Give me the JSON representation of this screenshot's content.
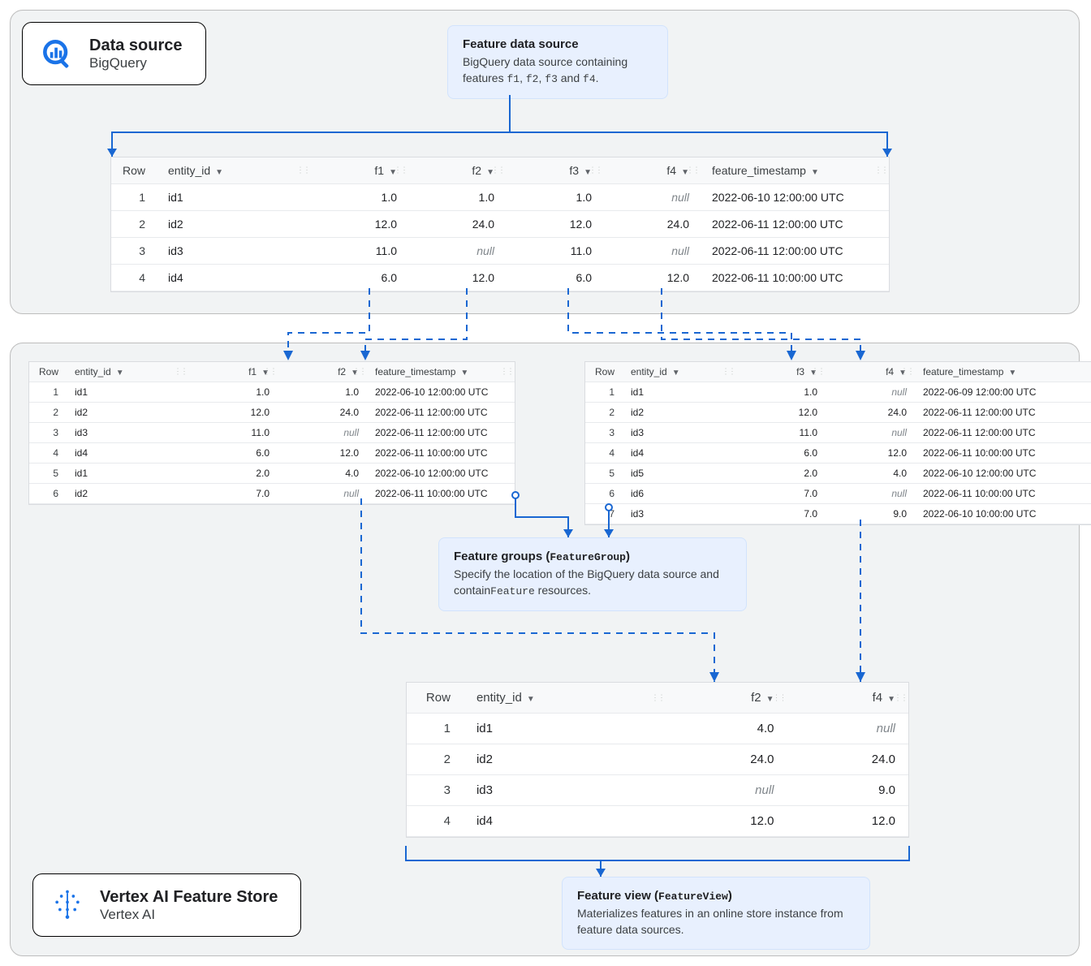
{
  "data_source_card": {
    "title": "Data source",
    "subtitle": "BigQuery"
  },
  "vertex_card": {
    "title": "Vertex AI Feature Store",
    "subtitle": "Vertex AI"
  },
  "callout_source": {
    "title": "Feature data source",
    "desc_pre": "BigQuery data source containing features ",
    "f1": "f1",
    "f2": "f2",
    "f3": "f3",
    "f4": "f4",
    "desc_mid": ", ",
    "desc_mid2": ", ",
    "desc_and": " and ",
    "desc_post": "."
  },
  "callout_groups": {
    "title_a": "Feature groups (",
    "title_code": "FeatureGroup",
    "title_b": ")",
    "desc_a": "Specify the location of the BigQuery data source and contain",
    "desc_code": "Feature",
    "desc_b": " resources."
  },
  "callout_view": {
    "title_a": "Feature view (",
    "title_code": "FeatureView",
    "title_b": ")",
    "desc": "Materializes features in an online store instance from feature data sources."
  },
  "main_table": {
    "headers": [
      "Row",
      "entity_id",
      "f1",
      "f2",
      "f3",
      "f4",
      "feature_timestamp"
    ],
    "rows": [
      {
        "row": "1",
        "entity_id": "id1",
        "f1": "1.0",
        "f2": "1.0",
        "f3": "1.0",
        "f4": null,
        "ts": "2022-06-10 12:00:00 UTC"
      },
      {
        "row": "2",
        "entity_id": "id2",
        "f1": "12.0",
        "f2": "24.0",
        "f3": "12.0",
        "f4": "24.0",
        "ts": "2022-06-11 12:00:00 UTC"
      },
      {
        "row": "3",
        "entity_id": "id3",
        "f1": "11.0",
        "f2": null,
        "f3": "11.0",
        "f4": null,
        "ts": "2022-06-11 12:00:00 UTC"
      },
      {
        "row": "4",
        "entity_id": "id4",
        "f1": "6.0",
        "f2": "12.0",
        "f3": "6.0",
        "f4": "12.0",
        "ts": "2022-06-11 10:00:00 UTC"
      }
    ]
  },
  "fg1_table": {
    "headers": [
      "Row",
      "entity_id",
      "f1",
      "f2",
      "feature_timestamp"
    ],
    "rows": [
      {
        "row": "1",
        "entity_id": "id1",
        "f1": "1.0",
        "f2": "1.0",
        "ts": "2022-06-10 12:00:00 UTC"
      },
      {
        "row": "2",
        "entity_id": "id2",
        "f1": "12.0",
        "f2": "24.0",
        "ts": "2022-06-11 12:00:00 UTC"
      },
      {
        "row": "3",
        "entity_id": "id3",
        "f1": "11.0",
        "f2": null,
        "ts": "2022-06-11 12:00:00 UTC"
      },
      {
        "row": "4",
        "entity_id": "id4",
        "f1": "6.0",
        "f2": "12.0",
        "ts": "2022-06-11 10:00:00 UTC"
      },
      {
        "row": "5",
        "entity_id": "id1",
        "f1": "2.0",
        "f2": "4.0",
        "ts": "2022-06-10 12:00:00 UTC"
      },
      {
        "row": "6",
        "entity_id": "id2",
        "f1": "7.0",
        "f2": null,
        "ts": "2022-06-11 10:00:00 UTC"
      }
    ]
  },
  "fg2_table": {
    "headers": [
      "Row",
      "entity_id",
      "f3",
      "f4",
      "feature_timestamp"
    ],
    "rows": [
      {
        "row": "1",
        "entity_id": "id1",
        "f3": "1.0",
        "f4": null,
        "ts": "2022-06-09 12:00:00 UTC"
      },
      {
        "row": "2",
        "entity_id": "id2",
        "f3": "12.0",
        "f4": "24.0",
        "ts": "2022-06-11 12:00:00 UTC"
      },
      {
        "row": "3",
        "entity_id": "id3",
        "f3": "11.0",
        "f4": null,
        "ts": "2022-06-11 12:00:00 UTC"
      },
      {
        "row": "4",
        "entity_id": "id4",
        "f3": "6.0",
        "f4": "12.0",
        "ts": "2022-06-11 10:00:00 UTC"
      },
      {
        "row": "5",
        "entity_id": "id5",
        "f3": "2.0",
        "f4": "4.0",
        "ts": "2022-06-10 12:00:00 UTC"
      },
      {
        "row": "6",
        "entity_id": "id6",
        "f3": "7.0",
        "f4": null,
        "ts": "2022-06-11 10:00:00 UTC"
      },
      {
        "row": "7",
        "entity_id": "id3",
        "f3": "7.0",
        "f4": "9.0",
        "ts": "2022-06-10 10:00:00 UTC"
      }
    ]
  },
  "view_table": {
    "headers": [
      "Row",
      "entity_id",
      "f2",
      "f4"
    ],
    "rows": [
      {
        "row": "1",
        "entity_id": "id1",
        "f2": "4.0",
        "f4": null
      },
      {
        "row": "2",
        "entity_id": "id2",
        "f2": "24.0",
        "f4": "24.0"
      },
      {
        "row": "3",
        "entity_id": "id3",
        "f2": null,
        "f4": "9.0"
      },
      {
        "row": "4",
        "entity_id": "id4",
        "f2": "12.0",
        "f4": "12.0"
      }
    ]
  },
  "null_label": "null"
}
